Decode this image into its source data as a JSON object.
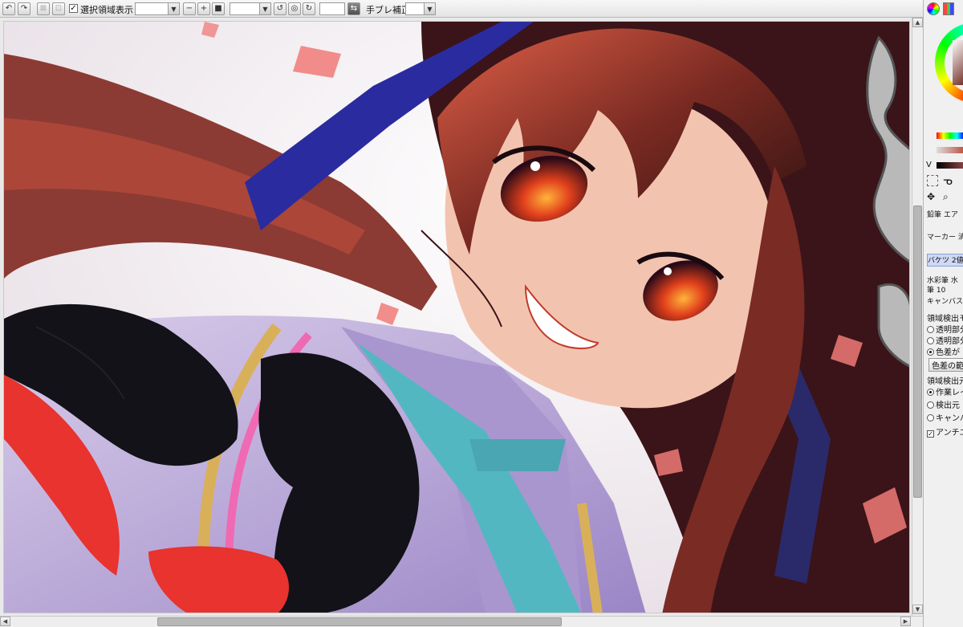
{
  "toolbar": {
    "show_selection_label": "選択領域表示",
    "show_selection_checked": "✓",
    "stabilizer_label": "手ブレ補正"
  },
  "panel": {
    "v_label": "V",
    "brushes": [
      "鉛筆",
      "エア",
      "マーカー",
      "消",
      "バケツ",
      "2値",
      "水彩筆",
      "水",
      "筆",
      "10",
      "キャンバス",
      "画"
    ],
    "detect_mode_label": "領域検出モ",
    "transparent_a": "透明部分",
    "transparent_b": "透明部分",
    "color_diff": "色差が",
    "color_diff_button": "色差の範",
    "detect_source_label": "領域検出元",
    "opt_working_layer": "作業レイ",
    "opt_source": "検出元",
    "opt_canvas": "キャンバ",
    "antialias": "アンチエイ"
  },
  "canvas": {
    "artwork_description_icon": "illustration-icon"
  },
  "colors": {
    "hair": "#8a2e22",
    "ribbon": "#2a2a9a",
    "skin": "#f2c4b0",
    "shirt": "#b9a8d6",
    "tie": "#53b7c2",
    "glove": "#121218",
    "accent_red": "#e8332e"
  }
}
